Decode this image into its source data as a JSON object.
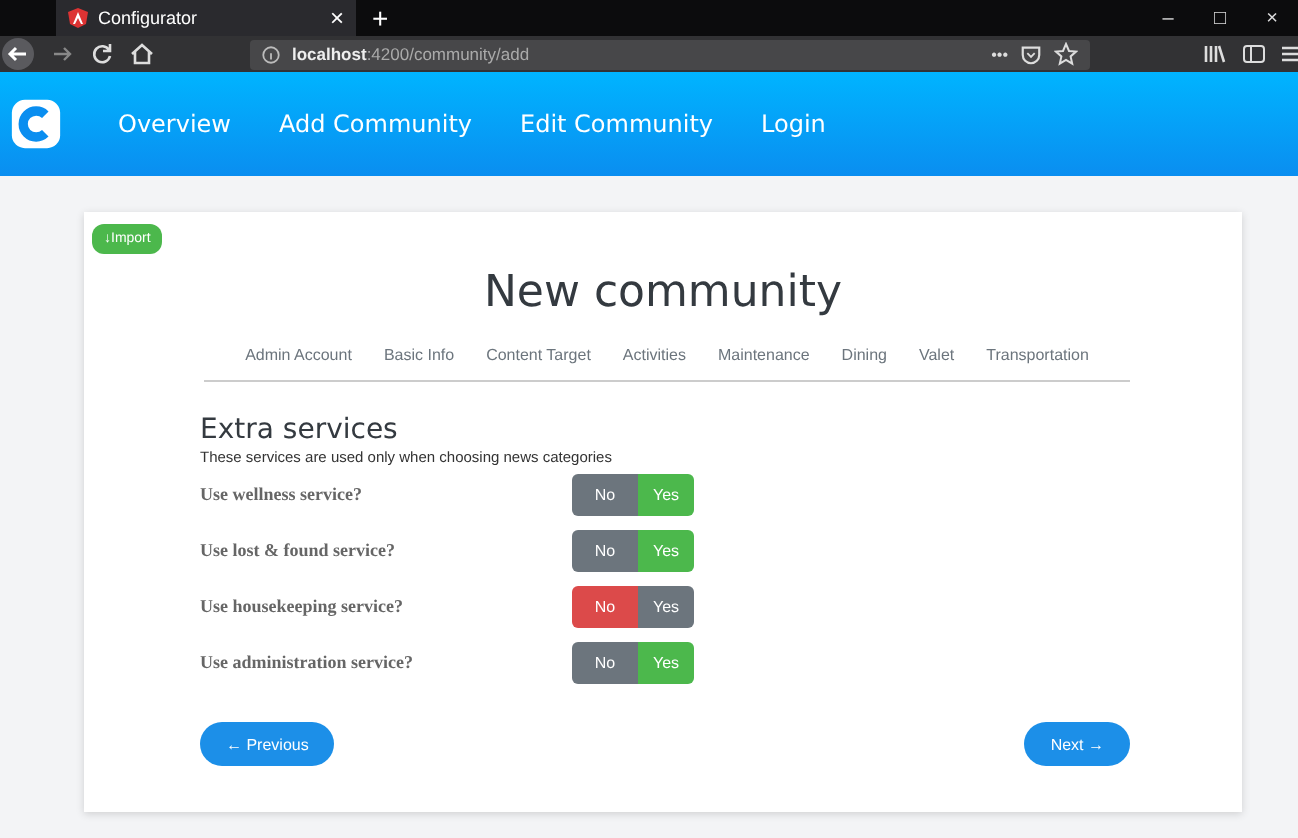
{
  "browser": {
    "tab_title": "Configurator",
    "tab_close": "×",
    "new_tab": "+",
    "url_host": "localhost",
    "url_rest": ":4200/community/add",
    "page_actions": "•••",
    "window_controls": [
      "–",
      "□",
      "×"
    ]
  },
  "nav": {
    "items": [
      "Overview",
      "Add Community",
      "Edit Community",
      "Login"
    ]
  },
  "import_button": "↓Import",
  "title": "New community",
  "steps": [
    "Admin Account",
    "Basic Info",
    "Content Target",
    "Activities",
    "Maintenance",
    "Dining",
    "Valet",
    "Transportation"
  ],
  "section": {
    "heading": "Extra services",
    "description": "These services are used only when choosing news categories"
  },
  "services": [
    {
      "label": "Use wellness service?",
      "no": "No",
      "yes": "Yes",
      "enabled": true
    },
    {
      "label": "Use lost & found service?",
      "no": "No",
      "yes": "Yes",
      "enabled": true
    },
    {
      "label": "Use housekeeping service?",
      "no": "No",
      "yes": "Yes",
      "enabled": false
    },
    {
      "label": "Use administration service?",
      "no": "No",
      "yes": "Yes",
      "enabled": true
    }
  ],
  "buttons": {
    "previous": "← Previous",
    "next": "Next →"
  }
}
